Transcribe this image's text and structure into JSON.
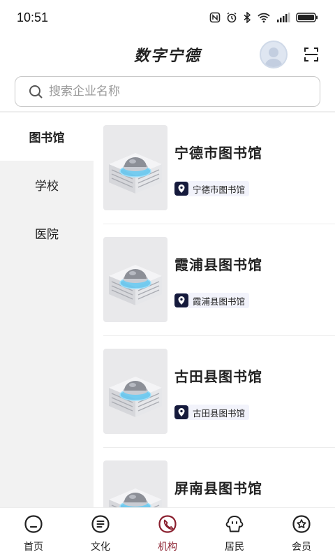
{
  "status_bar": {
    "time": "10:51",
    "battery_color": "#222222"
  },
  "header": {
    "title": "数字宁德",
    "accent": "#8a1f2e"
  },
  "search": {
    "placeholder": "搜索企业名称",
    "value": ""
  },
  "sidebar": {
    "items": [
      {
        "label": "图书馆",
        "active": true
      },
      {
        "label": "学校",
        "active": false
      },
      {
        "label": "医院",
        "active": false
      }
    ]
  },
  "list": {
    "items": [
      {
        "title": "宁德市图书馆",
        "tag": "宁德市图书馆"
      },
      {
        "title": "霞浦县图书馆",
        "tag": "霞浦县图书馆"
      },
      {
        "title": "古田县图书馆",
        "tag": "古田县图书馆"
      },
      {
        "title": "屏南县图书馆",
        "tag": ""
      }
    ]
  },
  "bottom_nav": {
    "items": [
      {
        "label": "首页",
        "icon": "home-icon",
        "active": false
      },
      {
        "label": "文化",
        "icon": "culture-icon",
        "active": false
      },
      {
        "label": "机构",
        "icon": "institution-icon",
        "active": true
      },
      {
        "label": "居民",
        "icon": "resident-icon",
        "active": false
      },
      {
        "label": "会员",
        "icon": "member-icon",
        "active": false
      }
    ]
  }
}
